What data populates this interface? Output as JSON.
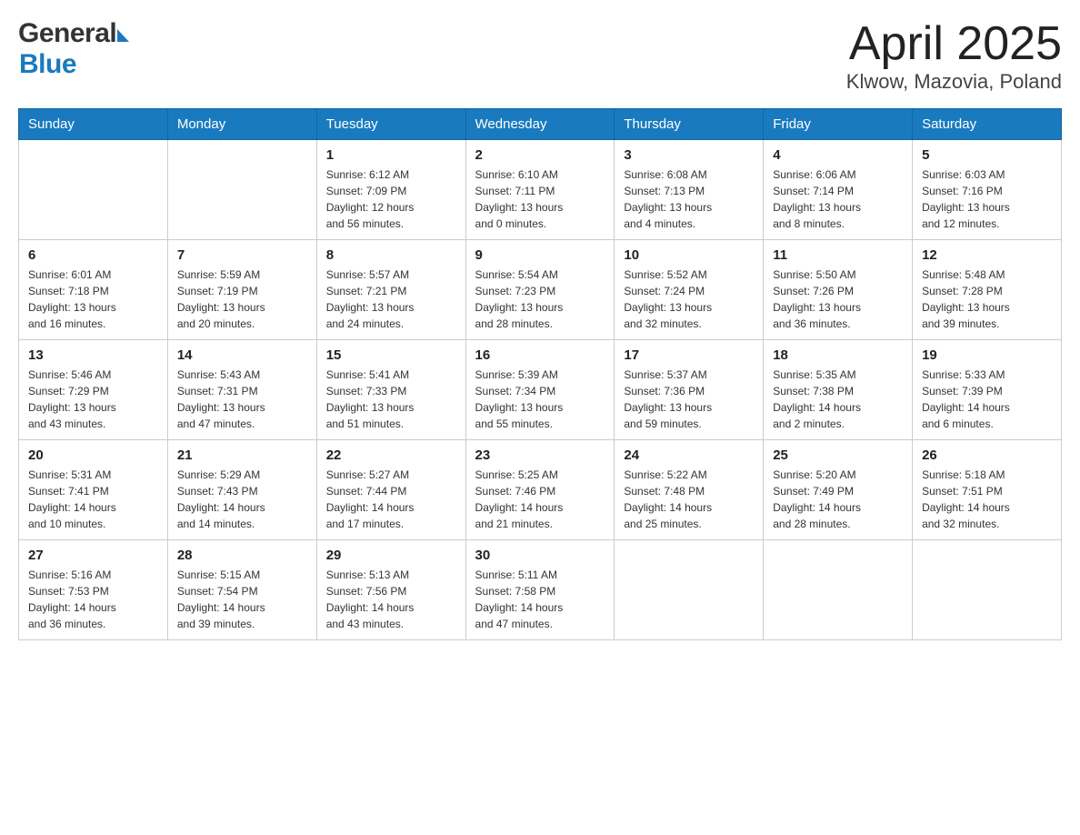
{
  "header": {
    "logo_general": "General",
    "logo_arrow": "▶",
    "logo_blue": "Blue",
    "title": "April 2025",
    "subtitle": "Klwow, Mazovia, Poland"
  },
  "days_of_week": [
    "Sunday",
    "Monday",
    "Tuesday",
    "Wednesday",
    "Thursday",
    "Friday",
    "Saturday"
  ],
  "weeks": [
    [
      {
        "day": "",
        "info": ""
      },
      {
        "day": "",
        "info": ""
      },
      {
        "day": "1",
        "info": "Sunrise: 6:12 AM\nSunset: 7:09 PM\nDaylight: 12 hours\nand 56 minutes."
      },
      {
        "day": "2",
        "info": "Sunrise: 6:10 AM\nSunset: 7:11 PM\nDaylight: 13 hours\nand 0 minutes."
      },
      {
        "day": "3",
        "info": "Sunrise: 6:08 AM\nSunset: 7:13 PM\nDaylight: 13 hours\nand 4 minutes."
      },
      {
        "day": "4",
        "info": "Sunrise: 6:06 AM\nSunset: 7:14 PM\nDaylight: 13 hours\nand 8 minutes."
      },
      {
        "day": "5",
        "info": "Sunrise: 6:03 AM\nSunset: 7:16 PM\nDaylight: 13 hours\nand 12 minutes."
      }
    ],
    [
      {
        "day": "6",
        "info": "Sunrise: 6:01 AM\nSunset: 7:18 PM\nDaylight: 13 hours\nand 16 minutes."
      },
      {
        "day": "7",
        "info": "Sunrise: 5:59 AM\nSunset: 7:19 PM\nDaylight: 13 hours\nand 20 minutes."
      },
      {
        "day": "8",
        "info": "Sunrise: 5:57 AM\nSunset: 7:21 PM\nDaylight: 13 hours\nand 24 minutes."
      },
      {
        "day": "9",
        "info": "Sunrise: 5:54 AM\nSunset: 7:23 PM\nDaylight: 13 hours\nand 28 minutes."
      },
      {
        "day": "10",
        "info": "Sunrise: 5:52 AM\nSunset: 7:24 PM\nDaylight: 13 hours\nand 32 minutes."
      },
      {
        "day": "11",
        "info": "Sunrise: 5:50 AM\nSunset: 7:26 PM\nDaylight: 13 hours\nand 36 minutes."
      },
      {
        "day": "12",
        "info": "Sunrise: 5:48 AM\nSunset: 7:28 PM\nDaylight: 13 hours\nand 39 minutes."
      }
    ],
    [
      {
        "day": "13",
        "info": "Sunrise: 5:46 AM\nSunset: 7:29 PM\nDaylight: 13 hours\nand 43 minutes."
      },
      {
        "day": "14",
        "info": "Sunrise: 5:43 AM\nSunset: 7:31 PM\nDaylight: 13 hours\nand 47 minutes."
      },
      {
        "day": "15",
        "info": "Sunrise: 5:41 AM\nSunset: 7:33 PM\nDaylight: 13 hours\nand 51 minutes."
      },
      {
        "day": "16",
        "info": "Sunrise: 5:39 AM\nSunset: 7:34 PM\nDaylight: 13 hours\nand 55 minutes."
      },
      {
        "day": "17",
        "info": "Sunrise: 5:37 AM\nSunset: 7:36 PM\nDaylight: 13 hours\nand 59 minutes."
      },
      {
        "day": "18",
        "info": "Sunrise: 5:35 AM\nSunset: 7:38 PM\nDaylight: 14 hours\nand 2 minutes."
      },
      {
        "day": "19",
        "info": "Sunrise: 5:33 AM\nSunset: 7:39 PM\nDaylight: 14 hours\nand 6 minutes."
      }
    ],
    [
      {
        "day": "20",
        "info": "Sunrise: 5:31 AM\nSunset: 7:41 PM\nDaylight: 14 hours\nand 10 minutes."
      },
      {
        "day": "21",
        "info": "Sunrise: 5:29 AM\nSunset: 7:43 PM\nDaylight: 14 hours\nand 14 minutes."
      },
      {
        "day": "22",
        "info": "Sunrise: 5:27 AM\nSunset: 7:44 PM\nDaylight: 14 hours\nand 17 minutes."
      },
      {
        "day": "23",
        "info": "Sunrise: 5:25 AM\nSunset: 7:46 PM\nDaylight: 14 hours\nand 21 minutes."
      },
      {
        "day": "24",
        "info": "Sunrise: 5:22 AM\nSunset: 7:48 PM\nDaylight: 14 hours\nand 25 minutes."
      },
      {
        "day": "25",
        "info": "Sunrise: 5:20 AM\nSunset: 7:49 PM\nDaylight: 14 hours\nand 28 minutes."
      },
      {
        "day": "26",
        "info": "Sunrise: 5:18 AM\nSunset: 7:51 PM\nDaylight: 14 hours\nand 32 minutes."
      }
    ],
    [
      {
        "day": "27",
        "info": "Sunrise: 5:16 AM\nSunset: 7:53 PM\nDaylight: 14 hours\nand 36 minutes."
      },
      {
        "day": "28",
        "info": "Sunrise: 5:15 AM\nSunset: 7:54 PM\nDaylight: 14 hours\nand 39 minutes."
      },
      {
        "day": "29",
        "info": "Sunrise: 5:13 AM\nSunset: 7:56 PM\nDaylight: 14 hours\nand 43 minutes."
      },
      {
        "day": "30",
        "info": "Sunrise: 5:11 AM\nSunset: 7:58 PM\nDaylight: 14 hours\nand 47 minutes."
      },
      {
        "day": "",
        "info": ""
      },
      {
        "day": "",
        "info": ""
      },
      {
        "day": "",
        "info": ""
      }
    ]
  ]
}
